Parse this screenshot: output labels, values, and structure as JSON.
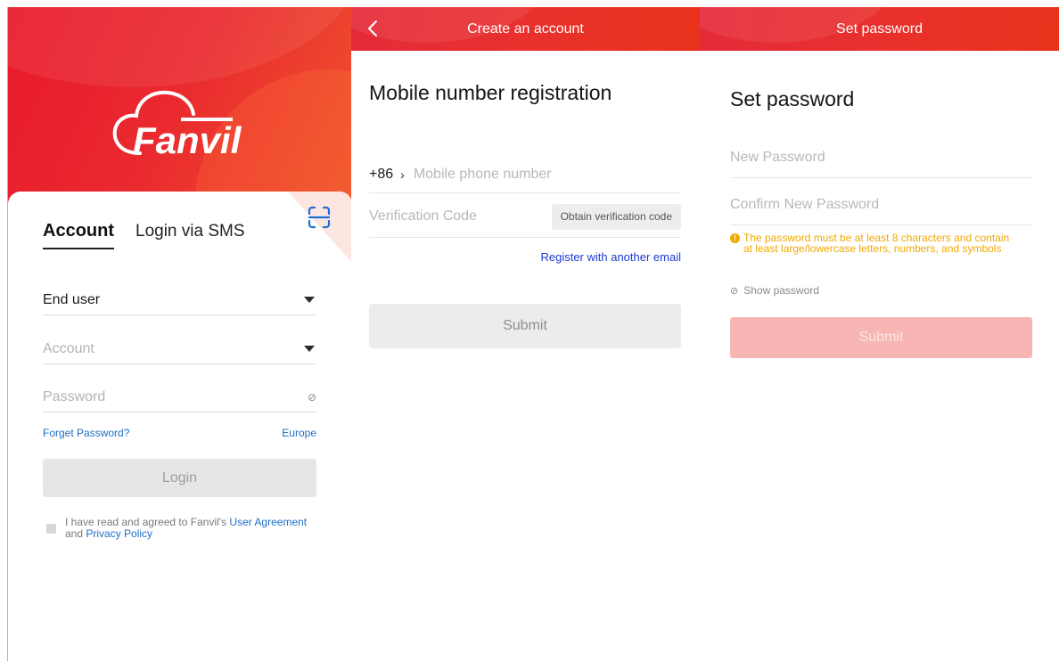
{
  "colors": {
    "brand_red": "#e8192c",
    "brand_orange": "#ef5a2c",
    "link_blue": "#1c6fc7",
    "email_link_blue": "#1e3bd1",
    "warning": "#f2a900",
    "submit_disabled_pink": "#f7b6b3"
  },
  "login": {
    "logo_text": "Fanvil",
    "tabs": [
      {
        "label": "Account",
        "active": true
      },
      {
        "label": "Login via SMS",
        "active": false
      }
    ],
    "role_select": {
      "value": "End user",
      "icon": "caret-down-icon"
    },
    "account_field": {
      "placeholder": "Account",
      "icon": "caret-down-icon"
    },
    "password_field": {
      "placeholder": "Password",
      "icon": "eye-hidden-icon"
    },
    "forget_password": "Forget Password?",
    "region": "Europe",
    "login_button": "Login",
    "agreement": {
      "prefix": "I have read and agreed to Fanvil's",
      "user_agreement": "User Agreement",
      "and": "and",
      "privacy_policy": "Privacy Policy"
    }
  },
  "register": {
    "title": "Create an account",
    "heading": "Mobile number registration",
    "country_code": "+86",
    "phone_placeholder": "Mobile phone number",
    "code_placeholder": "Verification Code",
    "obtain_code": "Obtain verification code",
    "email_link": "Register with another email",
    "submit": "Submit"
  },
  "password": {
    "title": "Set password",
    "heading": "Set password",
    "new_password_placeholder": "New Password",
    "confirm_password_placeholder": "Confirm New Password",
    "rule_text": "The password must be at least 8 characters and contain at least large/lowercase letters, numbers, and symbols",
    "show_password": "Show password",
    "submit": "Submit"
  }
}
